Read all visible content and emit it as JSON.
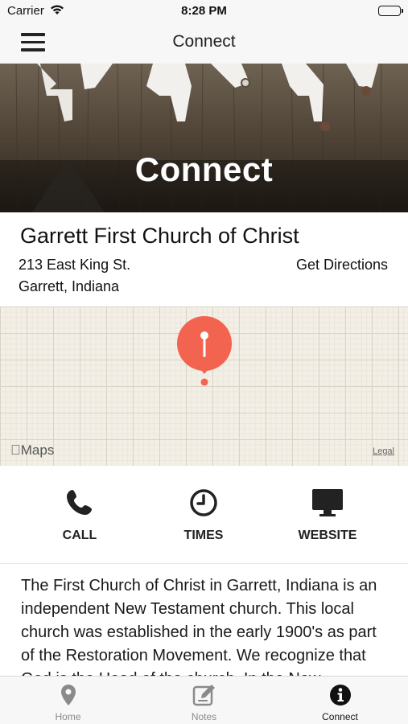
{
  "status_bar": {
    "carrier": "Carrier",
    "time": "8:28 PM"
  },
  "nav": {
    "title": "Connect"
  },
  "hero": {
    "title": "Connect"
  },
  "church": {
    "name": "Garrett First Church of Christ",
    "address_line1": "213 East King St.",
    "address_line2": "Garrett, Indiana",
    "directions_label": "Get Directions"
  },
  "map": {
    "logo_text": "Maps",
    "legal_label": "Legal"
  },
  "actions": [
    {
      "label": "CALL",
      "icon": "phone-icon"
    },
    {
      "label": "TIMES",
      "icon": "clock-icon"
    },
    {
      "label": "WEBSITE",
      "icon": "monitor-icon"
    }
  ],
  "about": {
    "text": "The First Church of Christ in Garrett, Indiana is an independent New Testament church.  This local church was established in the early 1900's as part of the Restoration Movement.  We recognize that God is the Head of the church.  In the New"
  },
  "tabs": [
    {
      "label": "Home",
      "icon": "location-pin-icon",
      "active": false
    },
    {
      "label": "Notes",
      "icon": "edit-note-icon",
      "active": false
    },
    {
      "label": "Connect",
      "icon": "info-icon",
      "active": true
    }
  ],
  "colors": {
    "accent_pin": "#f26350",
    "bar_background": "#f7f7f7",
    "active_tab": "#111111",
    "inactive_tab": "#8a8a8a"
  }
}
